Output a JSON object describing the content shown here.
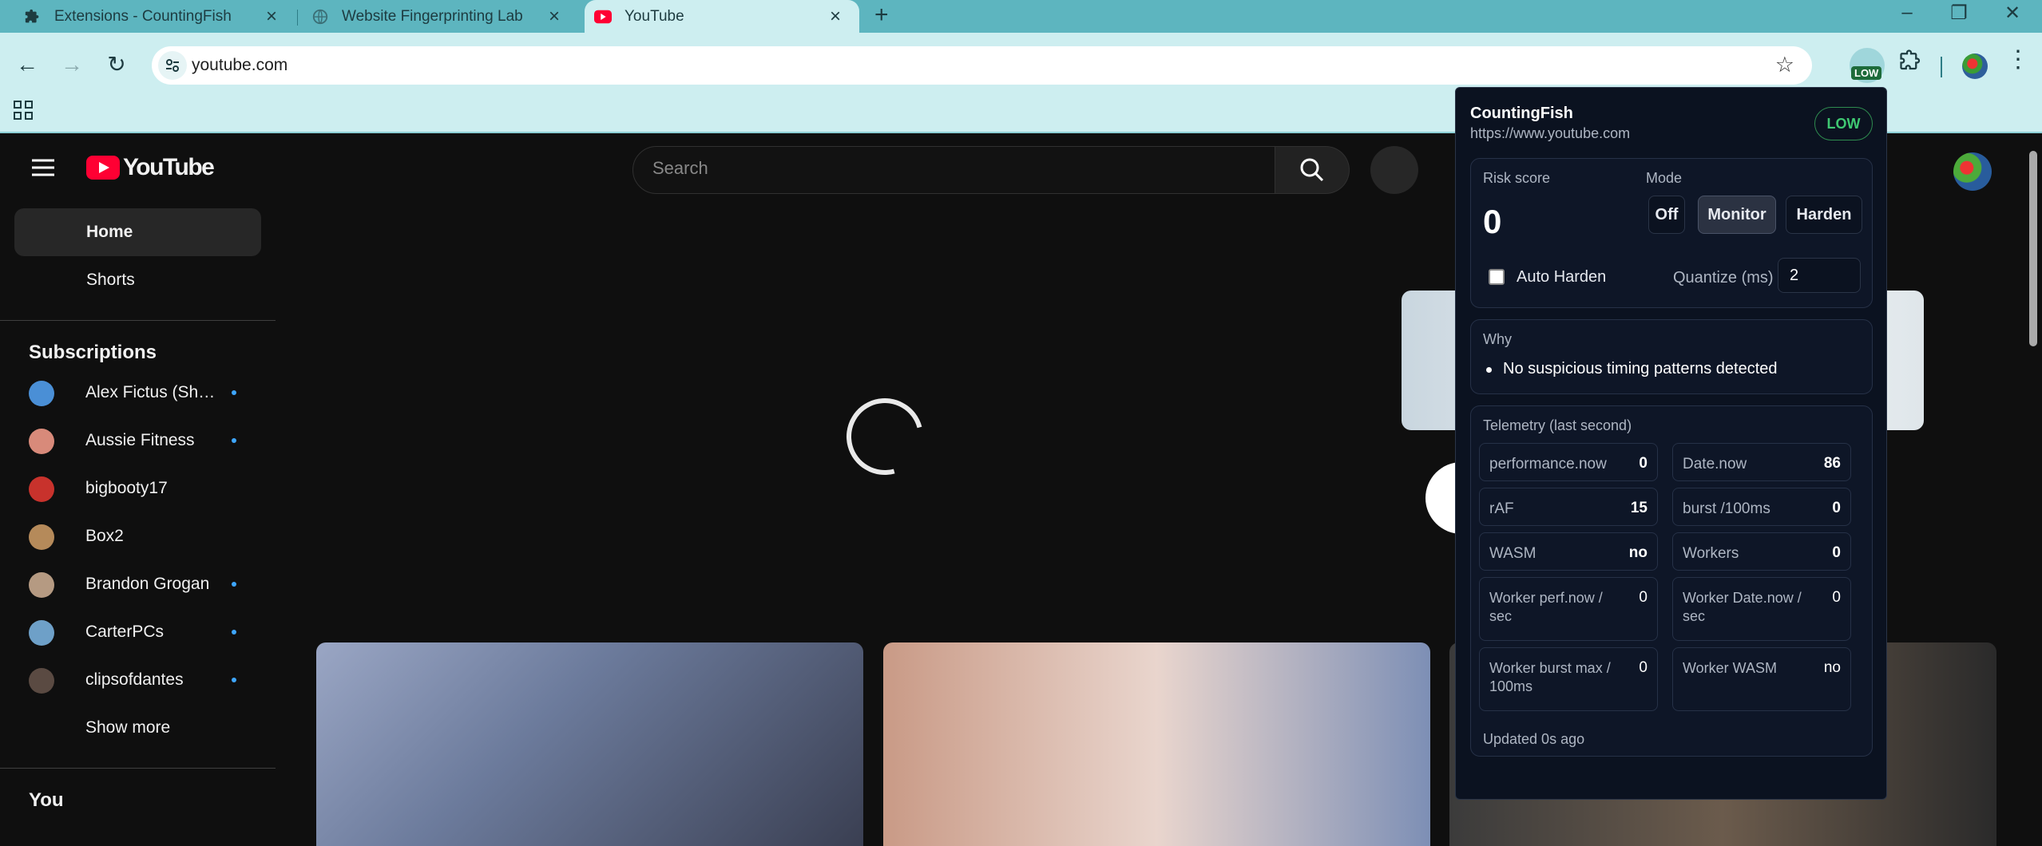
{
  "browser": {
    "tabs": [
      {
        "title": "Extensions - CountingFish",
        "icon": "puzzle-icon"
      },
      {
        "title": "Website Fingerprinting Lab",
        "icon": "blank-page-icon"
      },
      {
        "title": "YouTube",
        "icon": "youtube-icon",
        "active": true
      }
    ],
    "address": "youtube.com",
    "extension_badge": "LOW",
    "colors": {
      "tabbar": "#5db5bf",
      "toolbar": "#cdeef0"
    }
  },
  "youtube": {
    "logo_text": "YouTube",
    "search_placeholder": "Search",
    "nav": [
      {
        "label": "Home",
        "active": true
      },
      {
        "label": "Shorts"
      }
    ],
    "subscriptions_heading": "Subscriptions",
    "subscriptions": [
      {
        "name": "Alex Fictus (Sho...",
        "new": true,
        "color": "#4a8fd6"
      },
      {
        "name": "Aussie Fitness",
        "new": true,
        "color": "#d88a7a"
      },
      {
        "name": "bigbooty17",
        "new": false,
        "color": "#c8322c"
      },
      {
        "name": "Box2",
        "new": false,
        "color": "#b58a5a"
      },
      {
        "name": "Brandon Grogan",
        "new": true,
        "color": "#b59a82"
      },
      {
        "name": "CarterPCs",
        "new": true,
        "color": "#6ea0c8"
      },
      {
        "name": "clipsofdantes",
        "new": true,
        "color": "#5a4a42"
      }
    ],
    "show_more": "Show more",
    "you_heading": "You"
  },
  "popup": {
    "title": "CountingFish",
    "url": "https://www.youtube.com",
    "level": "LOW",
    "risk_score_label": "Risk score",
    "risk_score": "0",
    "mode_label": "Mode",
    "modes": [
      "Off",
      "Monitor",
      "Harden"
    ],
    "selected_mode": "Monitor",
    "auto_harden_label": "Auto Harden",
    "auto_harden": false,
    "quantize_label": "Quantize (ms)",
    "quantize_value": "2",
    "why_label": "Why",
    "why_items": [
      "No suspicious timing patterns detected"
    ],
    "telemetry_label": "Telemetry (last second)",
    "telemetry": [
      {
        "key": "performance.now",
        "value": "0"
      },
      {
        "key": "Date.now",
        "value": "86"
      },
      {
        "key": "rAF",
        "value": "15"
      },
      {
        "key": "burst /100ms",
        "value": "0"
      },
      {
        "key": "WASM",
        "value": "no"
      },
      {
        "key": "Workers",
        "value": "0"
      },
      {
        "key": "Worker perf.now / sec",
        "value": "0"
      },
      {
        "key": "Worker Date.now / sec",
        "value": "0"
      },
      {
        "key": "Worker burst max / 100ms",
        "value": "0"
      },
      {
        "key": "Worker WASM",
        "value": "no"
      }
    ],
    "updated": "Updated 0s ago",
    "colors": {
      "background": "#0b1220",
      "low_green": "#3fc872"
    }
  }
}
